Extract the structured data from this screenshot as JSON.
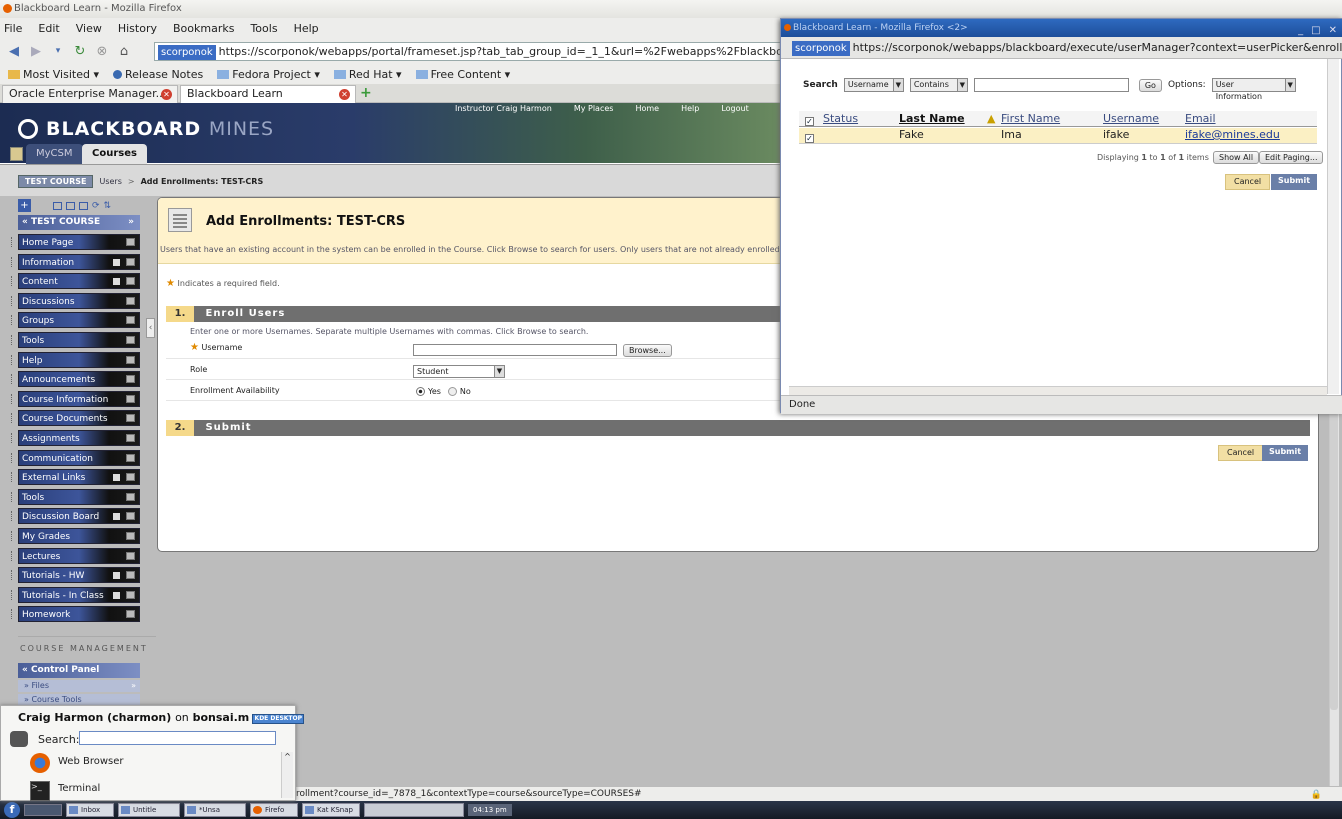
{
  "window": {
    "title": "Blackboard Learn - Mozilla Firefox"
  },
  "menubar": [
    "File",
    "Edit",
    "View",
    "History",
    "Bookmarks",
    "Tools",
    "Help"
  ],
  "urlbar": {
    "site": "scorponok",
    "url": "https://scorponok/webapps/portal/frameset.jsp?tab_tab_group_id=_1_1&url=%2Fwebapps%2Fblackboard%2Fexecute%2F"
  },
  "bookmarks": [
    "Most Visited ▾",
    "Release Notes",
    "Fedora Project ▾",
    "Red Hat ▾",
    "Free Content ▾"
  ],
  "tabs": [
    "Oracle Enterprise Manager...",
    "Blackboard Learn"
  ],
  "bb": {
    "logo_main": "BLACKBOARD",
    "logo_sub": "MINES",
    "top_links": [
      "Instructor Craig Harmon",
      "My Places",
      "Home",
      "Help",
      "Logout"
    ],
    "nav_tabs": [
      "MyCSM",
      "Courses"
    ],
    "breadcrumb": {
      "course": "TEST COURSE",
      "users": "Users",
      "sep": ">",
      "current": "Add Enrollments: TEST-CRS"
    },
    "menu_title": "TEST COURSE",
    "menu_items": [
      "Home Page",
      "Information",
      "Content",
      "Discussions",
      "Groups",
      "Tools",
      "Help",
      "Announcements",
      "Course Information",
      "Course Documents",
      "Assignments",
      "Communication",
      "External Links",
      "Tools",
      "Discussion Board",
      "My Grades",
      "Lectures",
      "Tutorials - HW",
      "Tutorials - In Class",
      "Homework"
    ],
    "course_management": "COURSE MANAGEMENT",
    "control_panel": "Control Panel",
    "cp_items": [
      "Files",
      "Course Tools"
    ],
    "page_title": "Add Enrollments: TEST-CRS",
    "intro": "Users that have an existing account in the system can be enrolled in the Course. Click Browse to search for users. Only users that are not already enrolled in",
    "required_note": "Indicates a required field.",
    "section1_num": "1.",
    "section1": "Enroll Users",
    "section1_help": "Enter one or more Usernames. Separate multiple Usernames with commas. Click Browse to search.",
    "username_label": "Username",
    "browse": "Browse...",
    "role_label": "Role",
    "role_value": "Student",
    "availability_label": "Enrollment Availability",
    "yes": "Yes",
    "no": "No",
    "section2_num": "2.",
    "section2": "Submit",
    "cancel": "Cancel",
    "submit": "Submit"
  },
  "status_text": "rollment?course_id=_7878_1&contextType=course&sourceType=COURSES#",
  "kde": {
    "user": "Craig Harmon (charmon)",
    "on": "on",
    "host": "bonsai.m",
    "badge": "KDE DESKTOP",
    "search_label": "Search:",
    "items": [
      "Web Browser",
      "Terminal"
    ]
  },
  "taskbar": [
    "Inbox",
    "Untitle",
    "*Unsa",
    "Firefo",
    "Kat KSnap"
  ],
  "clock": "04:13 pm",
  "popup": {
    "title": "Blackboard Learn - Mozilla Firefox <2>",
    "site": "scorponok",
    "url": "https://scorponok/webapps/blackboard/execute/userManager?context=userPicker&enrollTypeString=L",
    "search_label": "Search",
    "field": "Username",
    "op": "Contains",
    "go": "Go",
    "options_label": "Options:",
    "options_value": "User Information",
    "headers": [
      "Status",
      "Last Name",
      "First Name",
      "Username",
      "Email"
    ],
    "rows": [
      {
        "last": "Fake",
        "first": "Ima",
        "username": "ifake",
        "email": "ifake@mines.edu"
      }
    ],
    "display_pre": "Displaying",
    "display_a": "1",
    "display_to": "to",
    "display_b": "1",
    "display_of": "of",
    "display_c": "1",
    "display_items": "items",
    "show_all": "Show All",
    "edit_paging": "Edit Paging...",
    "cancel": "Cancel",
    "submit": "Submit",
    "status": "Done"
  }
}
